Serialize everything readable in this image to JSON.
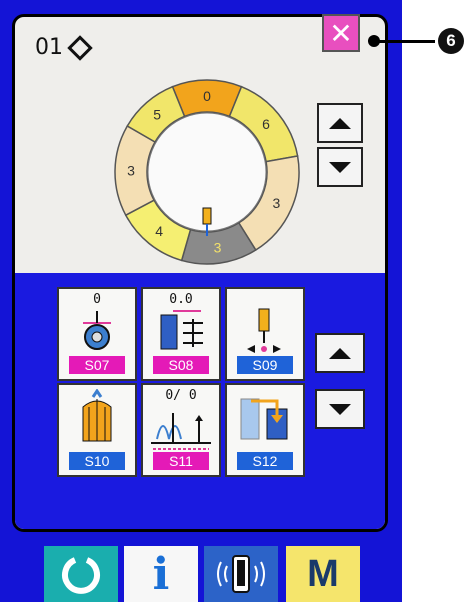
{
  "header": {
    "pattern_number": "01"
  },
  "close_button": {
    "label": "✕"
  },
  "callout": {
    "number": "6"
  },
  "ring": {
    "segments": [
      {
        "label": "0",
        "color": "#f2a41c"
      },
      {
        "label": "6",
        "color": "#f1e66a"
      },
      {
        "label": "3",
        "color": "#f4dfb4"
      },
      {
        "label": "3",
        "color": "#8a8a8a"
      },
      {
        "label": "4",
        "color": "#f5ef72"
      },
      {
        "label": "3",
        "color": "#f4dfb4"
      },
      {
        "label": "5",
        "color": "#f1e66a"
      }
    ]
  },
  "tiles": [
    {
      "value": "0",
      "label": "S07",
      "label_color": "pink"
    },
    {
      "value": "0.0",
      "label": "S08",
      "label_color": "pink"
    },
    {
      "value": "",
      "label": "S09",
      "label_color": "blue"
    },
    {
      "value": "",
      "label": "S10",
      "label_color": "blue"
    },
    {
      "value": "0/   0",
      "label": "S11",
      "label_color": "pink"
    },
    {
      "value": "",
      "label": "S12",
      "label_color": "blue"
    }
  ],
  "bottom_bar": {
    "info_label": "i",
    "mode_label": "M"
  },
  "colors": {
    "frame_blue": "#1414d6",
    "close_pink": "#e84fbf",
    "ready_teal": "#1aaeae",
    "mode_yellow": "#f5e56c"
  }
}
